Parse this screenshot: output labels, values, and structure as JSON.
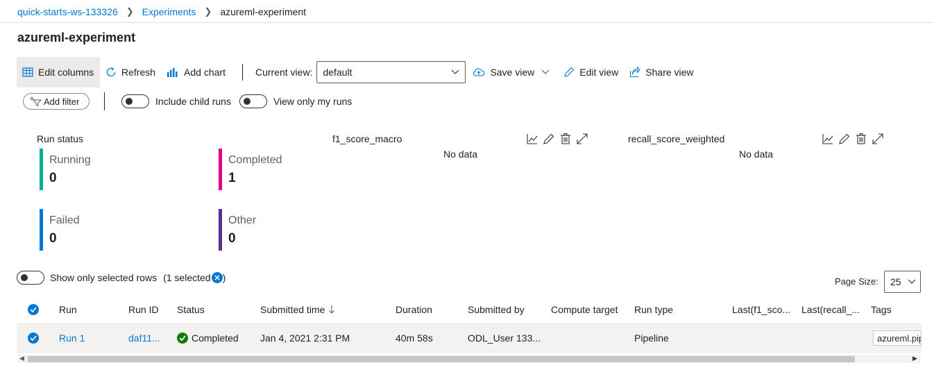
{
  "breadcrumb": {
    "workspace": "quick-starts-ws-133326",
    "section": "Experiments",
    "current": "azureml-experiment"
  },
  "page": {
    "title": "azureml-experiment"
  },
  "toolbar": {
    "edit_columns": "Edit columns",
    "refresh": "Refresh",
    "add_chart": "Add chart",
    "current_view_label": "Current view:",
    "current_view_value": "default",
    "save_view": "Save view",
    "edit_view": "Edit view",
    "share_view": "Share view"
  },
  "filters": {
    "add_filter": "Add filter",
    "include_child_runs": "Include child runs",
    "view_only_my_runs": "View only my runs"
  },
  "run_status": {
    "title": "Run status",
    "cards": [
      {
        "label": "Running",
        "value": "0",
        "color": "#00b294"
      },
      {
        "label": "Completed",
        "value": "1",
        "color": "#e3008c"
      },
      {
        "label": "Failed",
        "value": "0",
        "color": "#0078d4"
      },
      {
        "label": "Other",
        "value": "0",
        "color": "#5c2d91"
      }
    ]
  },
  "charts": [
    {
      "title": "f1_score_macro",
      "empty_text": "No data"
    },
    {
      "title": "recall_score_weighted",
      "empty_text": "No data"
    }
  ],
  "selection": {
    "show_only_selected": "Show only selected rows",
    "selected_open": "(1 selected",
    "selected_close": ")"
  },
  "pagination": {
    "label": "Page Size:",
    "value": "25"
  },
  "table": {
    "headers": {
      "run": "Run",
      "run_id": "Run ID",
      "status": "Status",
      "submitted_time": "Submitted time",
      "duration": "Duration",
      "submitted_by": "Submitted by",
      "compute_target": "Compute target",
      "run_type": "Run type",
      "last_f1": "Last(f1_sco...",
      "last_recall": "Last(recall_...",
      "tags": "Tags"
    },
    "rows": [
      {
        "run": "Run 1",
        "run_id": "daf11...",
        "status": "Completed",
        "submitted_time": "Jan 4, 2021 2:31 PM",
        "duration": "40m 58s",
        "submitted_by": "ODL_User 133...",
        "compute_target": "",
        "run_type": "Pipeline",
        "last_f1": "",
        "last_recall": "",
        "tag": "azureml.pip"
      }
    ]
  },
  "colors": {
    "accent": "#0078d4",
    "success": "#107c10"
  }
}
